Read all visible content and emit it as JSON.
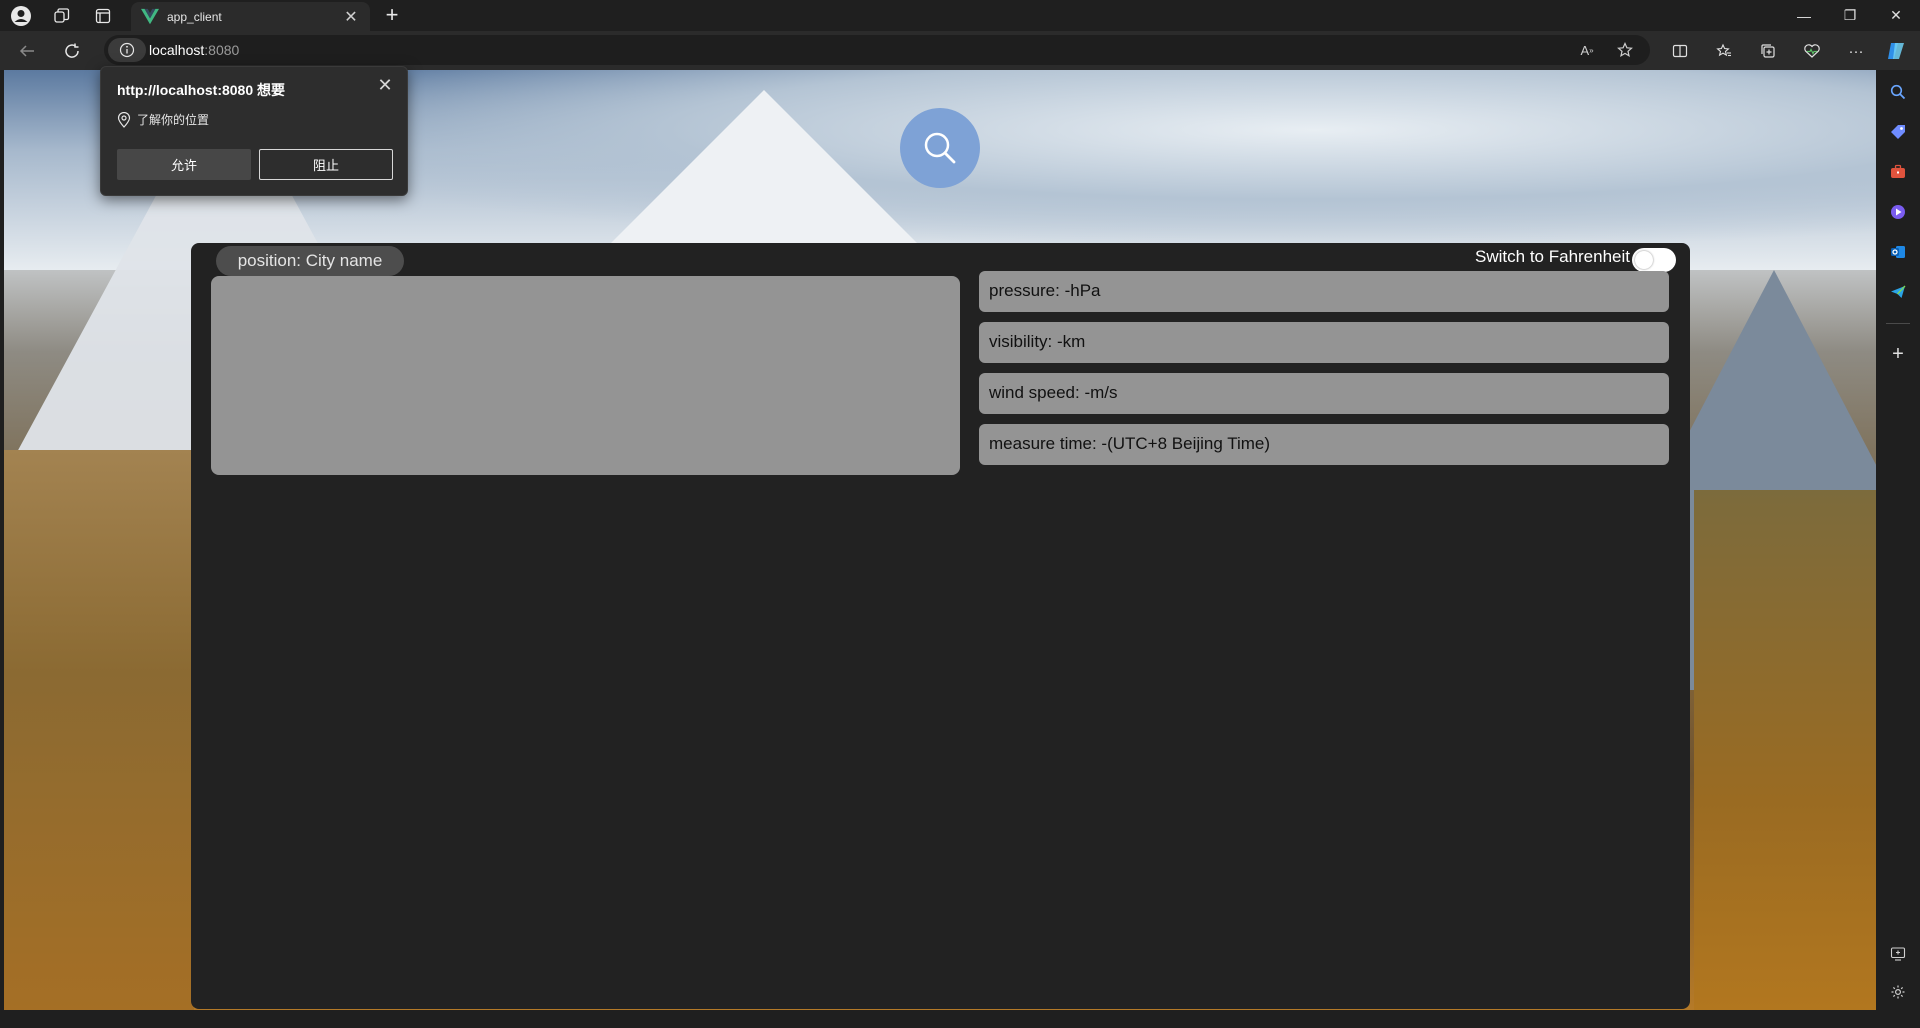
{
  "tab": {
    "title": "app_client",
    "close": "✕"
  },
  "newtab": "+",
  "address": {
    "host": "localhost",
    "port": ":8080"
  },
  "window": {
    "minimize": "—",
    "restore": "❐",
    "close": "✕"
  },
  "popup": {
    "title": "http://localhost:8080 想要",
    "permission": "了解你的位置",
    "allow": "允许",
    "block": "阻止"
  },
  "weather": {
    "position": "position: City name",
    "fahrenheit_label": "Switch to Fahrenheit",
    "fahrenheit_on": false,
    "pressure": "pressure: -hPa",
    "visibility": "visibility: -km",
    "wind": "wind speed: -m/s",
    "time": "measure time: -(UTC+8 Beijing Time)"
  },
  "colors": {
    "accent": "#7ea2d6",
    "card": "#949494",
    "panel": "#222222"
  }
}
